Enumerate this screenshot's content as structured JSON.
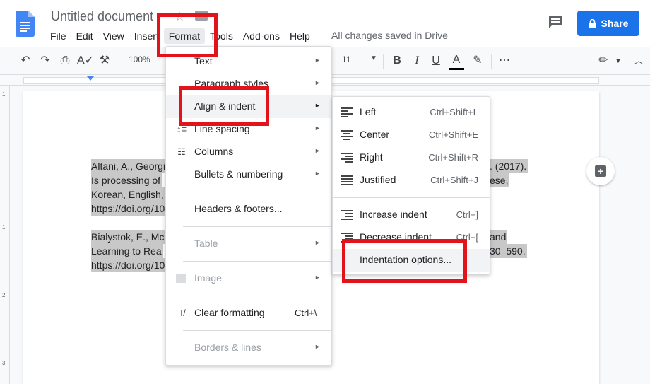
{
  "app": {
    "doc_title": "Untitled document",
    "save_status": "All changes saved in Drive",
    "share_label": "Share",
    "colors": {
      "accent": "#1a73e8",
      "annotation": "#e1141c",
      "selection": "#c8c8c8"
    }
  },
  "menubar": [
    "File",
    "Edit",
    "View",
    "Insert",
    "Format",
    "Tools",
    "Add-ons",
    "Help"
  ],
  "toolbar": {
    "zoom": "100%",
    "font_size": "11",
    "bold": "B",
    "italic": "I",
    "underline": "U",
    "text_color": "A",
    "more": "⋯"
  },
  "document": {
    "lines": [
      "Altani, A., Georgi",
      "Is processing of",
      "Korean, English,",
      "https://doi.org/10",
      "Bialystok, E., Mc",
      "Learning to Rea",
      "https://doi.org/10"
    ],
    "right_fragments": [
      ". (2017).",
      "ese,",
      "and",
      "30–590."
    ]
  },
  "format_menu": {
    "items": [
      {
        "label": "Text",
        "arrow": "►"
      },
      {
        "label": "Paragraph styles",
        "arrow": "►"
      },
      {
        "label": "Align & indent",
        "arrow": "►"
      },
      {
        "label": "Line spacing",
        "arrow": "►"
      },
      {
        "label": "Columns",
        "arrow": "►"
      },
      {
        "label": "Bullets & numbering",
        "arrow": "►"
      },
      {
        "label": "Headers & footers..."
      },
      {
        "label": "Table",
        "arrow": "►"
      },
      {
        "label": "Image",
        "arrow": "►"
      },
      {
        "label": "Clear formatting",
        "shortcut": "Ctrl+\\"
      },
      {
        "label": "Borders & lines",
        "arrow": "►"
      }
    ]
  },
  "align_submenu": {
    "items": [
      {
        "label": "Left",
        "shortcut": "Ctrl+Shift+L"
      },
      {
        "label": "Center",
        "shortcut": "Ctrl+Shift+E"
      },
      {
        "label": "Right",
        "shortcut": "Ctrl+Shift+R"
      },
      {
        "label": "Justified",
        "shortcut": "Ctrl+Shift+J"
      },
      {
        "label": "Increase indent",
        "shortcut": "Ctrl+]"
      },
      {
        "label": "Decrease indent",
        "shortcut": "Ctrl+["
      },
      {
        "label": "Indentation options..."
      }
    ]
  },
  "rulers": {
    "vertical_numbers": [
      "1",
      "1",
      "2",
      "3"
    ]
  }
}
